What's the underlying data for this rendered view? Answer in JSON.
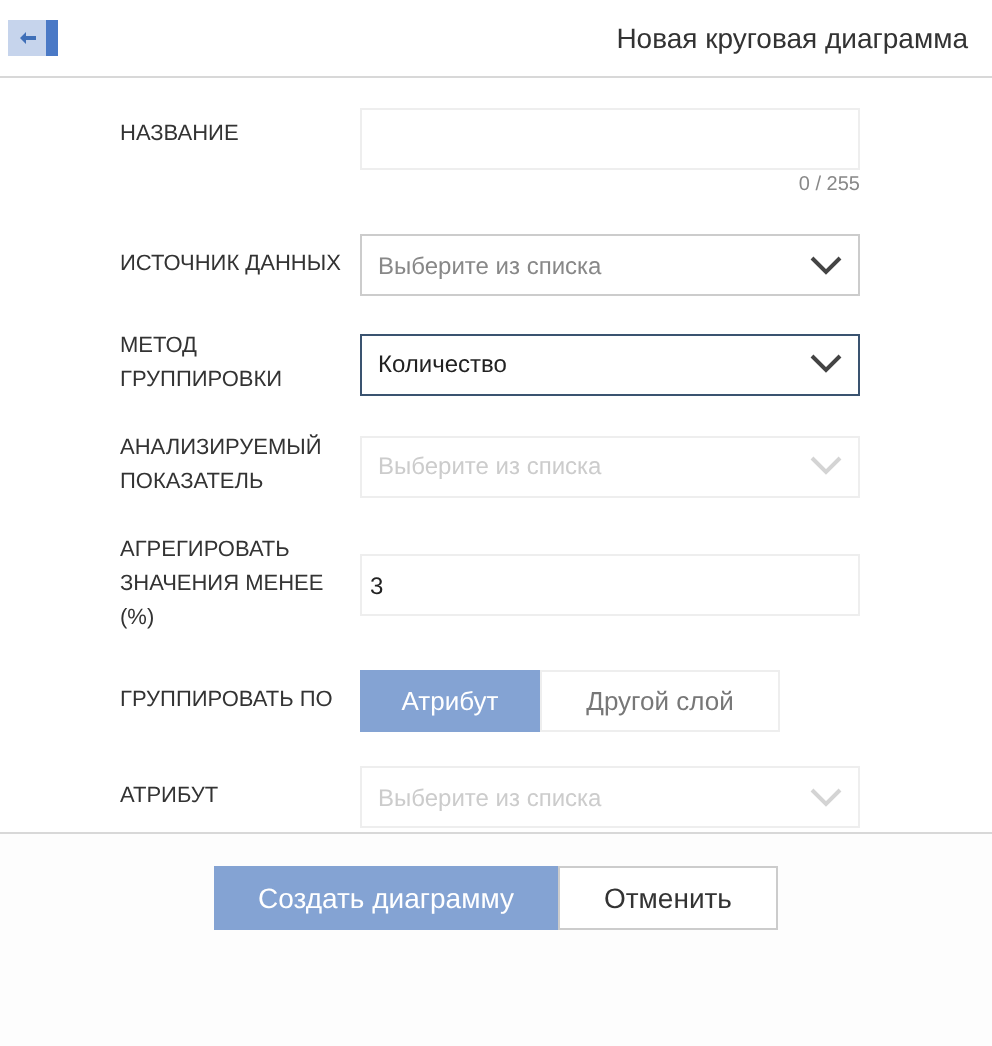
{
  "header": {
    "title": "Новая круговая диаграмма"
  },
  "fields": [
    {
      "kind": "text",
      "label": "НАЗВАНИЕ",
      "counter": "0 / 255"
    },
    {
      "kind": "select",
      "label": "ИСТОЧНИК ДАННЫХ",
      "placeholder": "Выберите из списка",
      "disabled": false,
      "focused": false
    },
    {
      "kind": "select",
      "label": "МЕТОД ГРУППИРОВКИ",
      "value": "Количество",
      "disabled": false,
      "focused": true
    },
    {
      "kind": "select",
      "label": "АНАЛИЗИРУЕМЫЙ ПОКАЗАТЕЛЬ",
      "placeholder": "Выберите из списка",
      "disabled": true,
      "focused": false
    },
    {
      "kind": "number",
      "label": "АГРЕГИРОВАТЬ ЗНАЧЕНИЯ МЕНЕЕ (%)",
      "value": "3"
    },
    {
      "kind": "toggle",
      "label": "ГРУППИРОВАТЬ ПО",
      "options": [
        {
          "label": "Атрибут",
          "selected": true
        },
        {
          "label": "Другой слой",
          "selected": false
        }
      ]
    },
    {
      "kind": "select",
      "label": "АТРИБУТ",
      "placeholder": "Выберите из списка",
      "disabled": true,
      "focused": false
    }
  ],
  "buttons": [
    {
      "label": "Создать диаграмму",
      "kind": "primary"
    },
    {
      "label": "Отменить",
      "kind": "secondary"
    }
  ]
}
